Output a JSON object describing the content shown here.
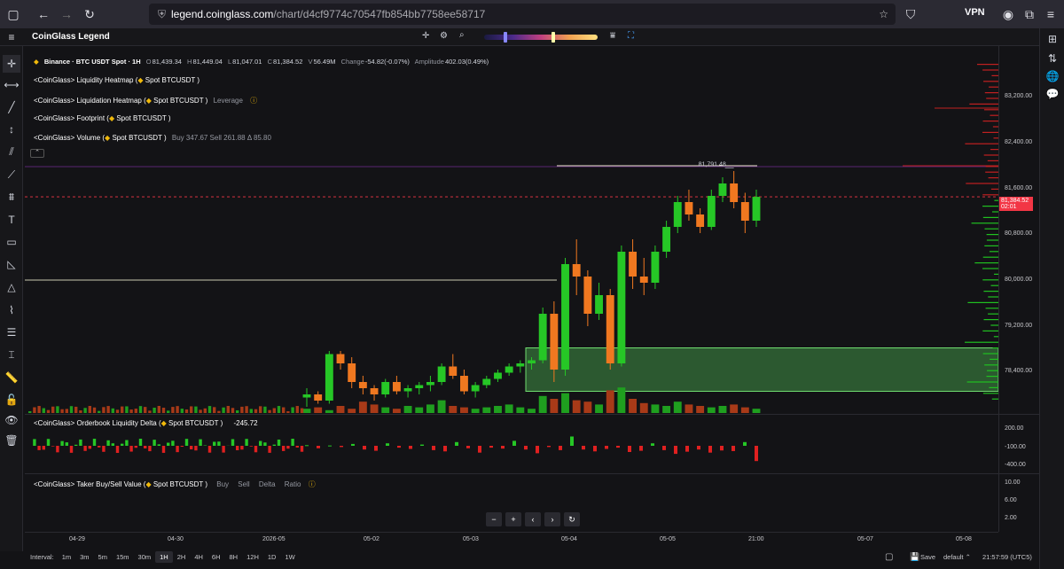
{
  "browser": {
    "url_host": "legend.coinglass.com",
    "url_path": "/chart/d4cf9774c70547fb854bb7758ee58717",
    "vpn_label": "VPN"
  },
  "app": {
    "title": "CoinGlass Legend"
  },
  "symbol": {
    "title": "Binance · BTC USDT Spot · 1H",
    "o_label": "O",
    "o": "81,439.34",
    "h_label": "H",
    "h": "81,449.04",
    "l_label": "L",
    "l": "81,047.01",
    "c_label": "C",
    "c": "81,384.52",
    "v_label": "V",
    "v": "56.49M",
    "change_label": "Change",
    "change": "-54.82(-0.07%)",
    "amp_label": "Amplitude",
    "amp": "402.03(0.49%)"
  },
  "indicators": [
    {
      "name": "<CoinGlass> Liquidity Heatmap",
      "params": "Spot BTCUSDT",
      "extra": ""
    },
    {
      "name": "<CoinGlass> Liquidation Heatmap",
      "params": "Spot BTCUSDT",
      "extra": "Leverage"
    },
    {
      "name": "<CoinGlass> Footprint",
      "params": "Spot BTCUSDT",
      "extra": ""
    },
    {
      "name": "<CoinGlass> Volume",
      "params": "Spot BTCUSDT",
      "extra": "Buy 347.67  Sell 261.88  Δ 85.80"
    }
  ],
  "high_label": "81,791.48",
  "price_axis": [
    "83,200.00",
    "82,400.00",
    "81,600.00",
    "80,800.00",
    "80,000.00",
    "79,200.00",
    "78,400.00"
  ],
  "current_price": "81,384.52",
  "countdown": "02:01",
  "orderbook": {
    "name": "<CoinGlass> Orderbook Liquidity Delta",
    "params": "Spot BTCUSDT",
    "value": "-245.72",
    "axis": [
      "200.00",
      "-100.00",
      "-400.00"
    ]
  },
  "taker": {
    "name": "<CoinGlass> Taker Buy/Sell Value",
    "params": "Spot BTCUSDT",
    "items": [
      "Buy",
      "Sell",
      "Delta",
      "Ratio"
    ],
    "axis": [
      "10.00",
      "6.00",
      "2.00"
    ]
  },
  "time_axis": [
    "04-29",
    "04-30",
    "2026-05",
    "05-02",
    "05-03",
    "05-04",
    "05-05",
    "21:00",
    "05-07",
    "05-08"
  ],
  "interval_label": "Interval:",
  "intervals": [
    "1m",
    "3m",
    "5m",
    "15m",
    "30m",
    "1H",
    "2H",
    "4H",
    "6H",
    "8H",
    "12H",
    "1D",
    "1W"
  ],
  "active_interval": "1H",
  "save_label": "Save",
  "layout_name": "default",
  "clock": "21:57:59 (UTC5)",
  "chart_data": {
    "type": "candlestick",
    "series": [
      {
        "name": "BTC USDT Spot",
        "values": [
          [
            78150,
            78300,
            78000,
            78200
          ],
          [
            78200,
            78250,
            78050,
            78100
          ],
          [
            78100,
            78900,
            78050,
            78850
          ],
          [
            78850,
            78900,
            78600,
            78700
          ],
          [
            78700,
            78800,
            78300,
            78400
          ],
          [
            78400,
            78500,
            78200,
            78300
          ],
          [
            78300,
            78350,
            78100,
            78200
          ],
          [
            78200,
            78450,
            78150,
            78400
          ],
          [
            78400,
            78500,
            78200,
            78250
          ],
          [
            78250,
            78350,
            78150,
            78300
          ],
          [
            78300,
            78400,
            78200,
            78350
          ],
          [
            78350,
            78500,
            78250,
            78400
          ],
          [
            78400,
            78700,
            78350,
            78650
          ],
          [
            78650,
            78850,
            78450,
            78500
          ],
          [
            78500,
            78600,
            78200,
            78250
          ],
          [
            78250,
            78400,
            78150,
            78350
          ],
          [
            78350,
            78500,
            78300,
            78450
          ],
          [
            78450,
            78600,
            78400,
            78550
          ],
          [
            78550,
            78700,
            78500,
            78650
          ],
          [
            78650,
            78750,
            78550,
            78700
          ],
          [
            78700,
            78800,
            78600,
            78750
          ],
          [
            78750,
            79600,
            78700,
            79500
          ],
          [
            79500,
            79700,
            78400,
            78600
          ],
          [
            78600,
            80400,
            78500,
            80300
          ],
          [
            80300,
            80700,
            79800,
            80100
          ],
          [
            80100,
            80200,
            79300,
            79500
          ],
          [
            79500,
            80000,
            79400,
            79800
          ],
          [
            79800,
            79900,
            78600,
            78700
          ],
          [
            78700,
            80600,
            78650,
            80500
          ],
          [
            80500,
            80700,
            79900,
            80100
          ],
          [
            80100,
            80400,
            79800,
            80000
          ],
          [
            80000,
            80600,
            79900,
            80500
          ],
          [
            80500,
            81000,
            80400,
            80900
          ],
          [
            80900,
            81400,
            80800,
            81300
          ],
          [
            81300,
            81500,
            81000,
            81100
          ],
          [
            81100,
            81200,
            80800,
            80900
          ],
          [
            80900,
            81500,
            80850,
            81400
          ],
          [
            81400,
            81700,
            81300,
            81600
          ],
          [
            81600,
            81800,
            81200,
            81300
          ],
          [
            81300,
            81450,
            80800,
            81000
          ],
          [
            81000,
            81500,
            80900,
            81384.52
          ]
        ]
      }
    ],
    "price_range": [
      77900,
      83700
    ],
    "x_labels": [
      "04-29",
      "04-30",
      "2026-05",
      "05-02",
      "05-03",
      "05-04",
      "05-05",
      "21:00"
    ],
    "high": 81791.48,
    "current": 81384.52,
    "zone": {
      "low": 78250,
      "high": 78950
    },
    "orderbook_delta": [
      10,
      -40,
      5,
      -20,
      30,
      -60,
      -80,
      40,
      -30,
      -50,
      20,
      -70,
      -90,
      60,
      -40,
      -110,
      -30,
      -45,
      80,
      -60,
      -120,
      -20,
      -70,
      150,
      -60,
      -90,
      -50,
      -30,
      -100,
      -80,
      40,
      -70,
      -130,
      -95,
      -60,
      -110,
      -75,
      -85,
      60,
      -245.72
    ],
    "orderbook_range": [
      -520,
      260
    ],
    "volume": [
      3,
      4,
      2,
      5,
      3,
      8,
      6,
      4,
      3,
      5,
      4,
      6,
      9,
      5,
      4,
      3,
      4,
      5,
      6,
      4,
      3,
      12,
      10,
      14,
      9,
      8,
      6,
      16,
      18,
      10,
      7,
      6,
      5,
      8,
      6,
      5,
      4,
      5,
      6,
      4,
      3
    ]
  }
}
